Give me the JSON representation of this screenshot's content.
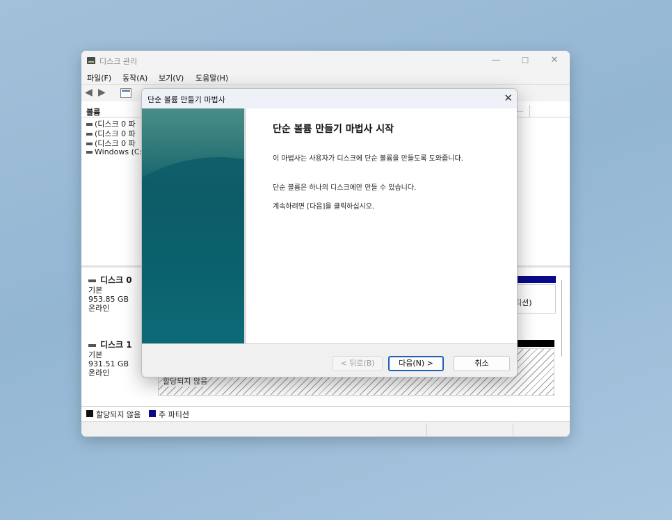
{
  "window": {
    "title": "디스크 관리",
    "controls": {
      "minimize": "—",
      "maximize": "☐",
      "close": "✕"
    },
    "menu": [
      "파일(F)",
      "동작(A)",
      "보기(V)",
      "도움말(H)"
    ],
    "volume_header": "볼륨",
    "header_ellipsis": "...",
    "volumes": [
      "(디스크 0 파",
      "(디스크 0 파",
      "(디스크 0 파",
      "Windows (C:)"
    ],
    "disks": [
      {
        "name": "디스크 0",
        "type": "기본",
        "size": "953.85 GB",
        "status": "온라인",
        "partition_text": "티션)"
      },
      {
        "name": "디스크 1",
        "type": "기본",
        "size": "931.51 GB",
        "status": "온라인",
        "partition_text": "할당되지 않음"
      }
    ],
    "legend": [
      {
        "label": "할당되지 않음",
        "color": "#111111"
      },
      {
        "label": "주 파티션",
        "color": "#0a0a8a"
      }
    ]
  },
  "dialog": {
    "title": "단순 볼륨 만들기 마법사",
    "close": "✕",
    "heading": "단순 볼륨 만들기 마법사 시작",
    "paragraphs": [
      "이 마법사는 사용자가 디스크에 단순 볼륨을 만들도록 도와줍니다.",
      "단순 볼륨은 하나의 디스크에만 만들 수 있습니다.",
      "계속하려면 [다음]을 클릭하십시오."
    ],
    "buttons": {
      "back": "< 뒤로(B)",
      "next": "다음(N) >",
      "cancel": "취소"
    }
  }
}
